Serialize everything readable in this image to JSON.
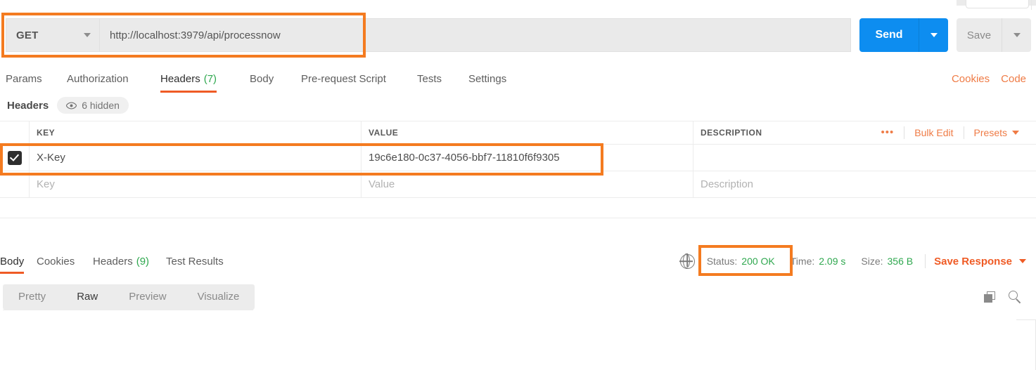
{
  "request": {
    "method": "GET",
    "url": "http://localhost:3979/api/processnow",
    "send_label": "Send",
    "save_label": "Save",
    "tabs": [
      {
        "label": "Params",
        "count": "",
        "active": false
      },
      {
        "label": "Authorization",
        "count": "",
        "active": false
      },
      {
        "label": "Headers",
        "count": "(7)",
        "active": true
      },
      {
        "label": "Body",
        "count": "",
        "active": false
      },
      {
        "label": "Pre-request Script",
        "count": "",
        "active": false
      },
      {
        "label": "Tests",
        "count": "",
        "active": false
      },
      {
        "label": "Settings",
        "count": "",
        "active": false
      }
    ],
    "cookies_link": "Cookies",
    "code_link": "Code"
  },
  "headers_section": {
    "title": "Headers",
    "hidden_pill": "6 hidden",
    "columns": {
      "key": "KEY",
      "value": "VALUE",
      "description": "DESCRIPTION"
    },
    "actions": {
      "dots": "•••",
      "bulk_edit": "Bulk Edit",
      "presets": "Presets"
    },
    "rows": [
      {
        "checked": true,
        "key": "X-Key",
        "value": "19c6e180-0c37-4056-bbf7-11810f6f9305",
        "description": ""
      }
    ],
    "placeholder_row": {
      "key": "Key",
      "value": "Value",
      "description": "Description"
    }
  },
  "response": {
    "tabs": [
      {
        "label": "Body",
        "count": "",
        "active": true
      },
      {
        "label": "Cookies",
        "count": "",
        "active": false
      },
      {
        "label": "Headers",
        "count": "(9)",
        "active": false
      },
      {
        "label": "Test Results",
        "count": "",
        "active": false
      }
    ],
    "status_label": "Status:",
    "status_value": "200 OK",
    "time_label": "Time:",
    "time_value": "2.09 s",
    "size_label": "Size:",
    "size_value": "356 B",
    "save_response": "Save Response",
    "view_modes": [
      {
        "label": "Pretty",
        "active": false
      },
      {
        "label": "Raw",
        "active": true
      },
      {
        "label": "Preview",
        "active": false
      },
      {
        "label": "Visualize",
        "active": false
      }
    ],
    "body_text": ""
  },
  "colors": {
    "accent_orange": "#ef5b25",
    "link_orange": "#ef7b45",
    "annotation_orange": "#f47b20",
    "send_blue": "#0d8df0",
    "status_green": "#2fa84f"
  }
}
